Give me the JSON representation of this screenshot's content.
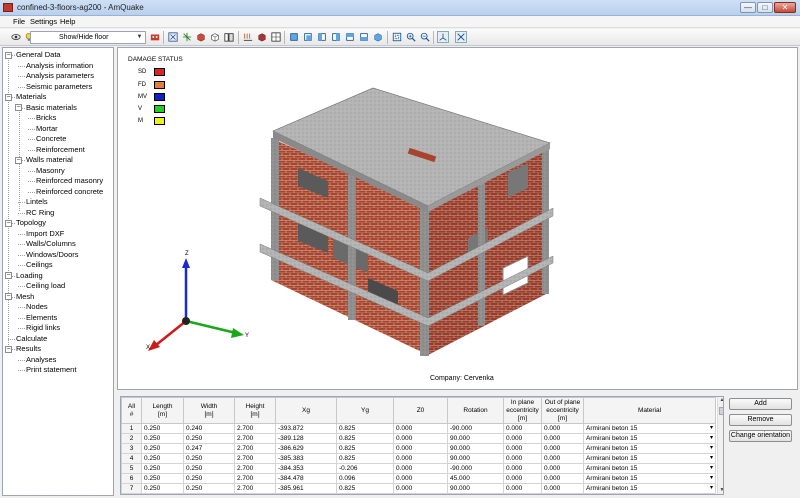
{
  "window": {
    "title": "confined-3-floors-ag200 - AmQuake",
    "minimize": "—",
    "maximize": "□",
    "close": "✕"
  },
  "menu": [
    "File",
    "Settings",
    "Help"
  ],
  "toolbar": {
    "floor_select": "Show/Hide floor"
  },
  "tree": [
    {
      "label": "General Data",
      "level": 0,
      "expand": "−"
    },
    {
      "label": "Analysis information",
      "level": 1
    },
    {
      "label": "Analysis parameters",
      "level": 1
    },
    {
      "label": "Seismic parameters",
      "level": 1
    },
    {
      "label": "Materials",
      "level": 0,
      "expand": "−"
    },
    {
      "label": "Basic materials",
      "level": 1,
      "expand": "−"
    },
    {
      "label": "Bricks",
      "level": 2
    },
    {
      "label": "Mortar",
      "level": 2
    },
    {
      "label": "Concrete",
      "level": 2
    },
    {
      "label": "Reinforcement",
      "level": 2
    },
    {
      "label": "Walls material",
      "level": 1,
      "expand": "−"
    },
    {
      "label": "Masonry",
      "level": 2
    },
    {
      "label": "Reinforced masonry",
      "level": 2
    },
    {
      "label": "Reinforced concrete",
      "level": 2
    },
    {
      "label": "Lintels",
      "level": 1
    },
    {
      "label": "RC Ring",
      "level": 1
    },
    {
      "label": "Topology",
      "level": 0,
      "expand": "−"
    },
    {
      "label": "Import DXF",
      "level": 1
    },
    {
      "label": "Walls/Columns",
      "level": 1
    },
    {
      "label": "Windows/Doors",
      "level": 1
    },
    {
      "label": "Ceilings",
      "level": 1
    },
    {
      "label": "Loading",
      "level": 0,
      "expand": "−"
    },
    {
      "label": "Ceiling load",
      "level": 1
    },
    {
      "label": "Mesh",
      "level": 0,
      "expand": "−"
    },
    {
      "label": "Nodes",
      "level": 1
    },
    {
      "label": "Elements",
      "level": 1
    },
    {
      "label": "Rigid links",
      "level": 1
    },
    {
      "label": "Calculate",
      "level": 0
    },
    {
      "label": "Results",
      "level": 0,
      "expand": "−"
    },
    {
      "label": "Analyses",
      "level": 1
    },
    {
      "label": "Print statement",
      "level": 1
    }
  ],
  "legend": {
    "title": "DAMAGE STATUS",
    "items": [
      {
        "code": "SD",
        "color": "#e02020"
      },
      {
        "code": "FD",
        "color": "#e87a3a"
      },
      {
        "code": "MV",
        "color": "#1020c8"
      },
      {
        "code": "V",
        "color": "#20d020"
      },
      {
        "code": "M",
        "color": "#f0f020"
      }
    ]
  },
  "axes": {
    "z": "Z",
    "x": "X",
    "y": "Y"
  },
  "company": "Company: Cervenka",
  "table": {
    "headers": [
      "All\n#",
      "Length\n[m]",
      "Width\n[m]",
      "Height\n[m]",
      "Xg",
      "Yg",
      "Z0",
      "Rotation",
      "In plane\neccentricity\n[m]",
      "Out of plane\neccentricity\n[m]",
      "Material"
    ],
    "rows": [
      [
        "1",
        "0.250",
        "0.240",
        "2.700",
        "-393.872",
        "0.825",
        "0.000",
        "-90.000",
        "0.000",
        "0.000",
        "Armirani beton 15"
      ],
      [
        "2",
        "0.250",
        "0.250",
        "2.700",
        "-389.128",
        "0.825",
        "0.000",
        "90.000",
        "0.000",
        "0.000",
        "Armirani beton 15"
      ],
      [
        "3",
        "0.250",
        "0.247",
        "2.700",
        "-386.629",
        "0.825",
        "0.000",
        "90.000",
        "0.000",
        "0.000",
        "Armirani beton 15"
      ],
      [
        "4",
        "0.250",
        "0.250",
        "2.700",
        "-385.383",
        "0.825",
        "0.000",
        "90.000",
        "0.000",
        "0.000",
        "Armirani beton 15"
      ],
      [
        "5",
        "0.250",
        "0.250",
        "2.700",
        "-384.353",
        "-0.206",
        "0.000",
        "-90.000",
        "0.000",
        "0.000",
        "Armirani beton 15"
      ],
      [
        "6",
        "0.250",
        "0.250",
        "2.700",
        "-384.478",
        "0.096",
        "0.000",
        "45.000",
        "0.000",
        "0.000",
        "Armirani beton 15"
      ],
      [
        "7",
        "0.250",
        "0.250",
        "2.700",
        "-385.961",
        "0.825",
        "0.000",
        "90.000",
        "0.000",
        "0.000",
        "Armirani beton 15"
      ]
    ]
  },
  "buttons": {
    "add": "Add",
    "remove": "Remove",
    "change_orientation": "Change orientation"
  }
}
